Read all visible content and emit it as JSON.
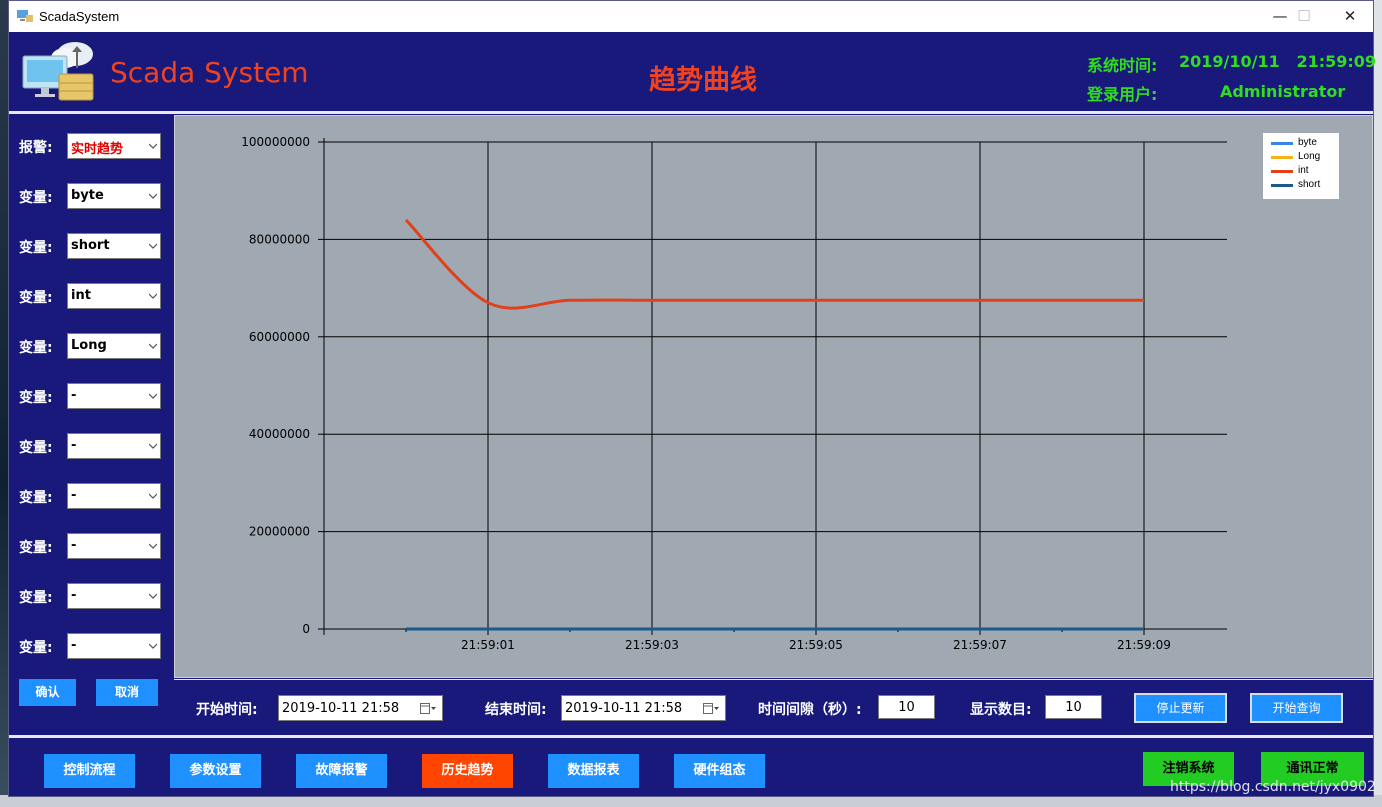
{
  "window": {
    "title": "ScadaSystem",
    "minimize": "—",
    "maximize": "☐",
    "close": "✕"
  },
  "header": {
    "brand": "Scada System",
    "page_title": "趋势曲线",
    "system_time_label": "系统时间:",
    "system_time_value": "2019/10/11   21:59:09",
    "login_user_label": "登录用户:",
    "login_user_value": "Administrator"
  },
  "sidebar": {
    "alarm_label": "报警:",
    "alarm_value": "实时趋势",
    "variables": [
      {
        "label": "变量:",
        "value": "byte"
      },
      {
        "label": "变量:",
        "value": "short"
      },
      {
        "label": "变量:",
        "value": "int"
      },
      {
        "label": "变量:",
        "value": "Long"
      },
      {
        "label": "变量:",
        "value": "-"
      },
      {
        "label": "变量:",
        "value": "-"
      },
      {
        "label": "变量:",
        "value": "-"
      },
      {
        "label": "变量:",
        "value": "-"
      },
      {
        "label": "变量:",
        "value": "-"
      },
      {
        "label": "变量:",
        "value": "-"
      }
    ],
    "confirm": "确认",
    "cancel": "取消"
  },
  "chart_data": {
    "type": "line",
    "title": "",
    "xlabel": "",
    "ylabel": "",
    "x": [
      "21:59:00",
      "21:59:01",
      "21:59:02",
      "21:59:03",
      "21:59:04",
      "21:59:05",
      "21:59:06",
      "21:59:07",
      "21:59:08",
      "21:59:09"
    ],
    "x_tick_labels": [
      "21:59:01",
      "21:59:03",
      "21:59:05",
      "21:59:07",
      "21:59:09"
    ],
    "y_tick_labels": [
      "100000000",
      "80000000",
      "60000000",
      "40000000",
      "20000000",
      "0"
    ],
    "ylim": [
      0,
      100000000
    ],
    "grid": true,
    "legend_position": "top-right",
    "series": [
      {
        "name": "byte",
        "color": "#3a86e8",
        "values": [
          0,
          0,
          0,
          0,
          0,
          0,
          0,
          0,
          0,
          0
        ]
      },
      {
        "name": "Long",
        "color": "#f5b31a",
        "values": [
          0,
          0,
          0,
          0,
          0,
          0,
          0,
          0,
          0,
          0
        ]
      },
      {
        "name": "int",
        "color": "#e0401a",
        "values": [
          84000000,
          67000000,
          67500000,
          67500000,
          67500000,
          67500000,
          67500000,
          67500000,
          67500000,
          67500000
        ]
      },
      {
        "name": "short",
        "color": "#1a5a8a",
        "values": [
          0,
          0,
          0,
          0,
          0,
          0,
          0,
          0,
          0,
          0
        ]
      }
    ]
  },
  "query": {
    "start_label": "开始时间:",
    "start_value": "2019-10-11 21:58",
    "end_label": "结束时间:",
    "end_value": "2019-10-11 21:58",
    "interval_label": "时间间隙（秒）:",
    "interval_value": "10",
    "count_label": "显示数目:",
    "count_value": "10",
    "stop_update": "停止更新",
    "start_query": "开始查询"
  },
  "nav": {
    "buttons": [
      "控制流程",
      "参数设置",
      "故障报警",
      "历史趋势",
      "数据报表",
      "硬件组态"
    ],
    "active_index": 3,
    "logout": "注销系统",
    "comm_status": "通讯正常"
  },
  "watermark": "https://blog.csdn.net/jyx0902",
  "colors": {
    "background": "#18197a",
    "accent": "#1e90ff",
    "active": "#ff4500",
    "status_green": "#2fde1d",
    "brand": "#f0421e",
    "plot_bg": "#a0a8b2"
  }
}
